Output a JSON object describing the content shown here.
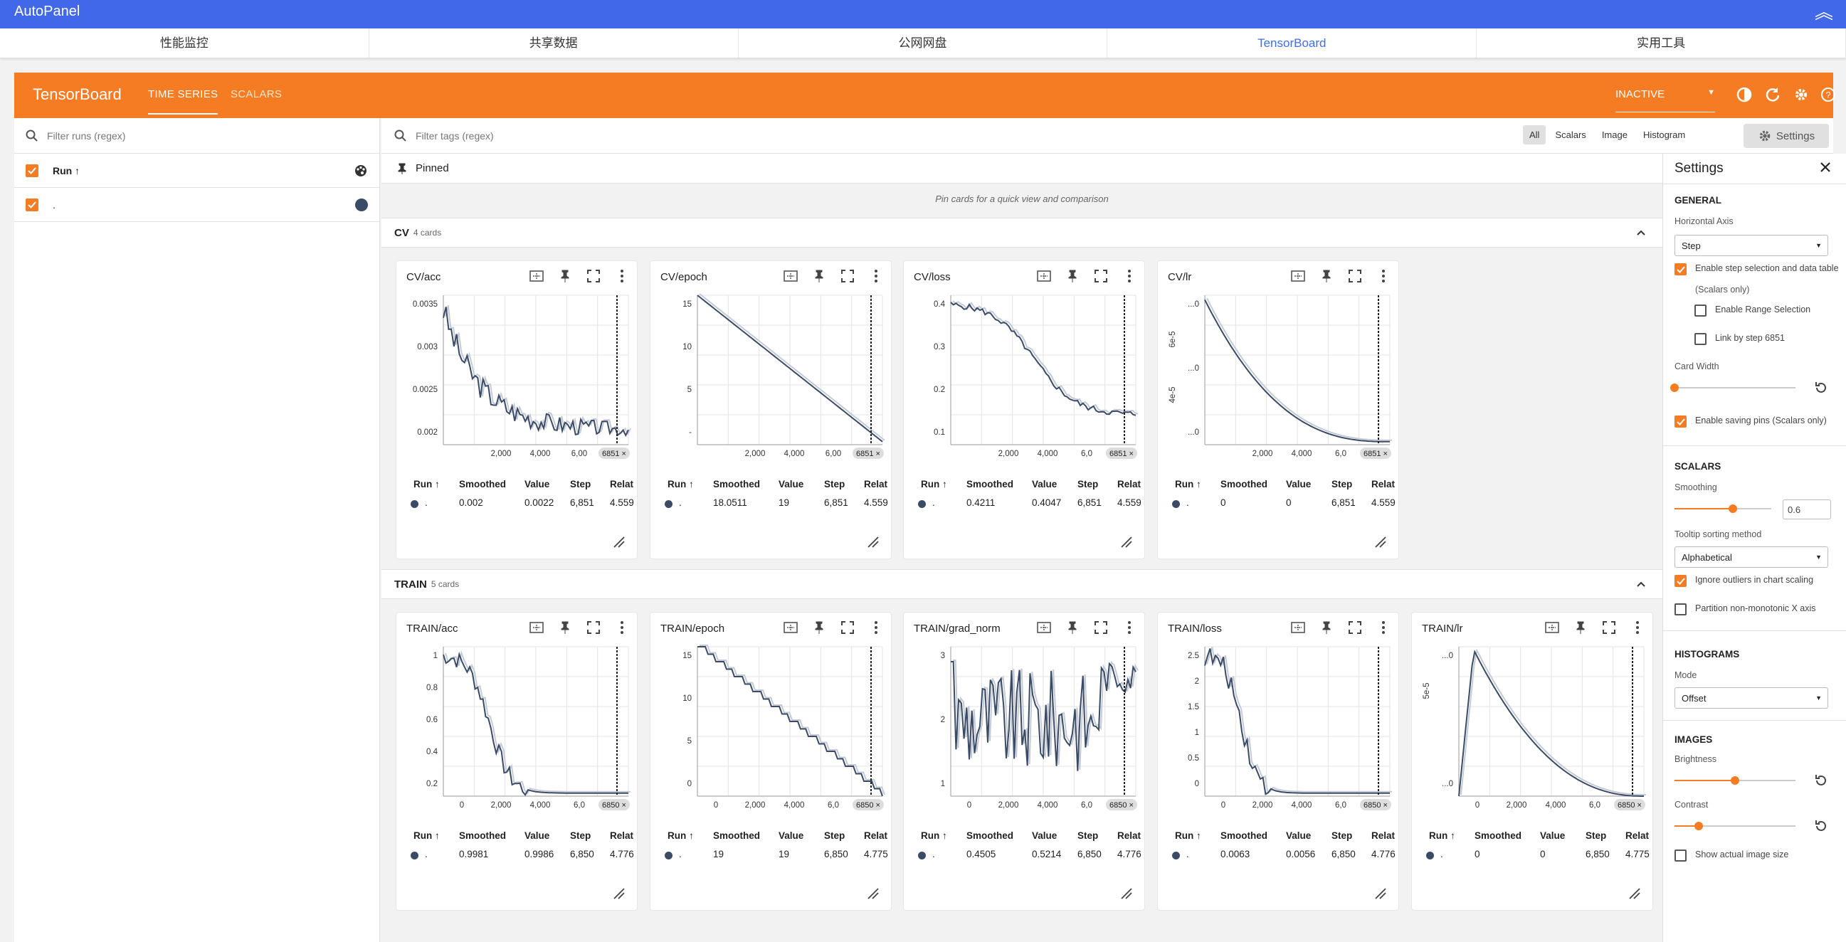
{
  "topbar": {
    "title": "AutoPanel"
  },
  "nav": [
    {
      "label": "性能监控"
    },
    {
      "label": "共享数据"
    },
    {
      "label": "公网网盘"
    },
    {
      "label": "TensorBoard"
    },
    {
      "label": "实用工具"
    }
  ],
  "tb": {
    "brand": "TensorBoard",
    "tab_timeseries": "TIME SERIES",
    "tab_scalars": "SCALARS",
    "status": "INACTIVE"
  },
  "runs": {
    "filter_placeholder": "Filter runs (regex)",
    "header": "Run ↑",
    "run_name": "."
  },
  "tags": {
    "filter_placeholder": "Filter tags (regex)",
    "types": [
      "All",
      "Scalars",
      "Image",
      "Histogram"
    ],
    "settings_label": "Settings"
  },
  "pinned": {
    "label": "Pinned",
    "hint": "Pin cards for a quick view and comparison"
  },
  "groups": [
    {
      "name": "CV",
      "count": "4 cards"
    },
    {
      "name": "TRAIN",
      "count": "5 cards"
    }
  ],
  "table_headers": {
    "run": "Run ↑",
    "smoothed": "Smoothed",
    "value": "Value",
    "step": "Step",
    "relat": "Relat"
  },
  "cards": [
    {
      "title": "CV/acc",
      "run": ".",
      "smoothed": "0.002",
      "value": "0.0022",
      "step": "6,851",
      "relat": "4.559",
      "xticks": [
        "2,000",
        "4,000",
        "6,00"
      ],
      "yticks": [
        "0.0035",
        "0.003",
        "0.0025",
        "0.002"
      ],
      "badge": "6851"
    },
    {
      "title": "CV/epoch",
      "run": ".",
      "smoothed": "18.0511",
      "value": "19",
      "step": "6,851",
      "relat": "4.559",
      "xticks": [
        "2,000",
        "4,000",
        "6,00"
      ],
      "yticks": [
        "15",
        "10",
        "5",
        "-"
      ],
      "badge": "6851"
    },
    {
      "title": "CV/loss",
      "run": ".",
      "smoothed": "0.4211",
      "value": "0.4047",
      "step": "6,851",
      "relat": "4.559",
      "xticks": [
        "2,000",
        "4,000",
        "6,0"
      ],
      "yticks": [
        "0.4",
        "0.3",
        "0.2",
        "0.1"
      ],
      "badge": "6851"
    },
    {
      "title": "CV/lr",
      "run": ".",
      "smoothed": "0",
      "value": "0",
      "step": "6,851",
      "relat": "4.559",
      "xticks": [
        "2,000",
        "4,000",
        "6,0"
      ],
      "yticks": [
        "...0",
        "...0",
        "...0"
      ],
      "ylabels": [
        "6e-5",
        "4e-5"
      ],
      "badge": "6851"
    },
    {
      "title": "TRAIN/acc",
      "run": ".",
      "smoothed": "0.9981",
      "value": "0.9986",
      "step": "6,850",
      "relat": "4.776",
      "xticks": [
        "0",
        "2,000",
        "4,000",
        "6,0"
      ],
      "yticks": [
        "1",
        "0.8",
        "0.6",
        "0.4",
        "0.2"
      ],
      "badge": "6850"
    },
    {
      "title": "TRAIN/epoch",
      "run": ".",
      "smoothed": "19",
      "value": "19",
      "step": "6,850",
      "relat": "4.775",
      "xticks": [
        "0",
        "2,000",
        "4,000",
        "6,0"
      ],
      "yticks": [
        "15",
        "10",
        "5",
        "0"
      ],
      "badge": "6850"
    },
    {
      "title": "TRAIN/grad_norm",
      "run": ".",
      "smoothed": "0.4505",
      "value": "0.5214",
      "step": "6,850",
      "relat": "4.776",
      "xticks": [
        "0",
        "2,000",
        "4,000",
        "6,0"
      ],
      "yticks": [
        "3",
        "2",
        "1"
      ],
      "badge": "6850"
    },
    {
      "title": "TRAIN/loss",
      "run": ".",
      "smoothed": "0.0063",
      "value": "0.0056",
      "step": "6,850",
      "relat": "4.776",
      "xticks": [
        "0",
        "2,000",
        "4,000",
        "6,0"
      ],
      "yticks": [
        "2.5",
        "2",
        "1.5",
        "1",
        "0.5",
        "0"
      ],
      "badge": "6850"
    },
    {
      "title": "TRAIN/lr",
      "run": ".",
      "smoothed": "0",
      "value": "0",
      "step": "6,850",
      "relat": "4.775",
      "xticks": [
        "0",
        "2,000",
        "4,000",
        "6,0"
      ],
      "yticks": [
        "...0",
        "...0"
      ],
      "ylabels": [
        "5e-5"
      ],
      "badge": "6850"
    }
  ],
  "settings": {
    "title": "Settings",
    "general": "GENERAL",
    "horizontal_axis": "Horizontal Axis",
    "axis_value": "Step",
    "enable_step": "Enable step selection and data table",
    "scalars_only": "(Scalars only)",
    "range_sel": "Enable Range Selection",
    "link_step": "Link by step 6851",
    "card_width": "Card Width",
    "saving_pins": "Enable saving pins (Scalars only)",
    "scalars": "SCALARS",
    "smoothing": "Smoothing",
    "smoothing_value": "0.6",
    "tooltip_sort": "Tooltip sorting method",
    "tooltip_value": "Alphabetical",
    "ignore_outliers": "Ignore outliers in chart scaling",
    "partition": "Partition non-monotonic X axis",
    "histograms": "HISTOGRAMS",
    "mode": "Mode",
    "mode_value": "Offset",
    "images": "IMAGES",
    "brightness": "Brightness",
    "contrast": "Contrast",
    "actual_size": "Show actual image size",
    "smoothing_level": 0.6,
    "brightness_level": 0.5,
    "contrast_level": 0.2,
    "card_width_level": 0.0
  },
  "colors": {
    "accent": "#f57c22",
    "topbar": "#4168e8",
    "series": "#3b4b66"
  }
}
